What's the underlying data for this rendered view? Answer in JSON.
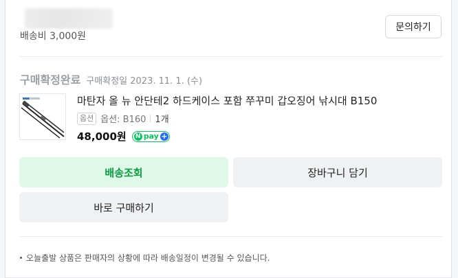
{
  "order": {
    "shipping_fee": "배송비 3,000원",
    "inquiry_button": "문의하기",
    "status": "구매확정완료",
    "confirm_date": "구매확정일 2023. 11. 1. (수)"
  },
  "product": {
    "name": "마탄자 올 뉴 안단테2 하드케이스 포함 쭈꾸미 갑오징어 낚시대 B150",
    "option_badge": "옵션",
    "option_value": "옵션: B160",
    "quantity": "1개",
    "price": "48,000원",
    "npay": {
      "n": "N",
      "label": "pay",
      "plus": "+"
    }
  },
  "actions": {
    "track": "배송조회",
    "cart": "장바구니 담기",
    "buy_again": "바로 구매하기"
  },
  "notice": "오늘출발 상품은 판매자의 상황에 따라 배송일정이 변경될 수 있습니다.",
  "colors": {
    "accent_green": "#0a9e44",
    "track_bg": "#dff8e7",
    "npay_green": "#03c75a",
    "npay_plus": "#1e6bff"
  }
}
